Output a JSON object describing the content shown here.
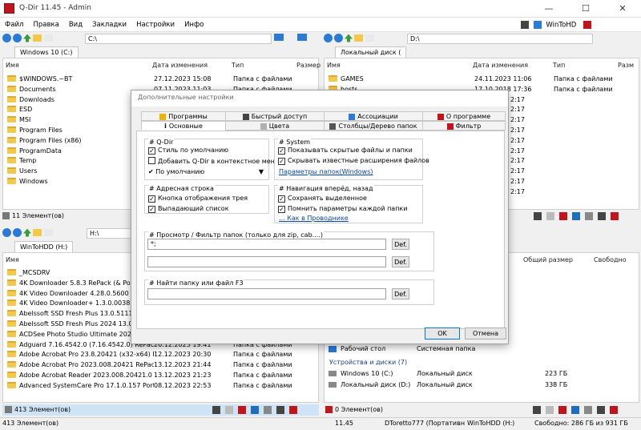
{
  "window": {
    "title": "Q-Dir 11.45 - Admin",
    "minimize": "—",
    "maximize": "☐",
    "close": "✕"
  },
  "menu": [
    "Файл",
    "Правка",
    "Вид",
    "Закладки",
    "Настройки",
    "Инфо"
  ],
  "menu_right": {
    "label": "WinToHD"
  },
  "pane_tl": {
    "address": "C:\\",
    "tab": "Windows 10 (C:)",
    "columns": [
      "Имя",
      "Дата изменения",
      "Тип",
      "Размер"
    ],
    "rows": [
      {
        "name": "$WINDOWS.~BT",
        "date": "27.12.2023 15:08",
        "type": "Папка с файлами"
      },
      {
        "name": "Documents",
        "date": "07.11.2023 11:03",
        "type": "Папка с файлами"
      },
      {
        "name": "Downloads",
        "date": "",
        "type": ""
      },
      {
        "name": "ESD",
        "date": "",
        "type": ""
      },
      {
        "name": "MSI",
        "date": "",
        "type": ""
      },
      {
        "name": "Program Files",
        "date": "",
        "type": ""
      },
      {
        "name": "Program Files (x86)",
        "date": "",
        "type": ""
      },
      {
        "name": "ProgramData",
        "date": "",
        "type": ""
      },
      {
        "name": "Temp",
        "date": "",
        "type": ""
      },
      {
        "name": "Users",
        "date": "",
        "type": ""
      },
      {
        "name": "Windows",
        "date": "",
        "type": ""
      }
    ],
    "status": "11 Элемент(ов)"
  },
  "pane_tr": {
    "address": "D:\\",
    "tab": "Локальный диск (",
    "columns": [
      "Имя",
      "Дата изменения",
      "Тип",
      "Разм"
    ],
    "rows": [
      {
        "name": "GAMES",
        "date": "24.11.2023 11:06",
        "type": "Папка с файлами"
      },
      {
        "name": "hosts",
        "date": "17.10.2018 17:36",
        "type": "Папка с файлами"
      },
      {
        "name": "",
        "date": "2:17",
        "type": ""
      },
      {
        "name": "",
        "date": "2:17",
        "type": ""
      },
      {
        "name": "",
        "date": "2:17",
        "type": ""
      },
      {
        "name": "",
        "date": "2:17",
        "type": ""
      },
      {
        "name": "",
        "date": "2:17",
        "type": ""
      },
      {
        "name": "",
        "date": "2:17",
        "type": ""
      },
      {
        "name": "",
        "date": "2:17",
        "type": ""
      },
      {
        "name": "",
        "date": "2:17",
        "type": ""
      },
      {
        "name": "",
        "date": "2:17",
        "type": ""
      },
      {
        "name": "",
        "date": "2:17",
        "type": ""
      }
    ]
  },
  "pane_bl": {
    "address": "H:\\",
    "tab": "WinToHDD (H:)",
    "columns": [
      "Имя"
    ],
    "rows": [
      {
        "name": "_MCSDRV",
        "date": "",
        "type": ""
      },
      {
        "name": "4K Downloader 5.8.3 RePack (& Portable",
        "date": "",
        "type": ""
      },
      {
        "name": "4K Video Downloader 4.28.0.5600 RePack",
        "date": "",
        "type": ""
      },
      {
        "name": "4K Video Downloader+ 1.3.0.0038 RePac",
        "date": "",
        "type": ""
      },
      {
        "name": "Abelssoft SSD Fresh Plus 13.0.51115 Port",
        "date": "",
        "type": ""
      },
      {
        "name": "Abelssoft SSD Fresh Plus 2024 13.0.5111",
        "date": "",
        "type": ""
      },
      {
        "name": "ACDSee Photo Studio Ultimate 2024 17.0",
        "date": "",
        "type": ""
      },
      {
        "name": "Adguard 7.16.4542.0 (7.16.4542.0) RePack by KpoJ...",
        "date": "26.12.2023 19:41",
        "type": "Папка с файлами"
      },
      {
        "name": "Adobe Acrobat Pro 23.8.20421 (x32-x64) RePack b...",
        "date": "12.12.2023 20:30",
        "type": "Папка с файлами"
      },
      {
        "name": "Adobe Acrobat Pro 2023.008.20421 RePack b...",
        "date": "13.12.2023 21:44",
        "type": "Папка с файлами"
      },
      {
        "name": "Adobe Acrobat Reader 2023.008.20421.0",
        "date": "13.12.2023 21:23",
        "type": "Папка с файлами"
      },
      {
        "name": "Advanced SystemCare Pro 17.1.0.157 Portab...",
        "date": "08.12.2023 22:53",
        "type": "Папка с файлами"
      }
    ],
    "status": "413 Элемент(ов)"
  },
  "pane_br": {
    "columns": [
      "Общий размер",
      "Свободно"
    ],
    "rows": [
      {
        "name": "Рабочий стол",
        "type": "Системная папка",
        "size": ""
      },
      {
        "name": "Устройства и диски (7)",
        "type": "",
        "size": ""
      },
      {
        "name": "Windows 10 (C:)",
        "type": "Локальный диск",
        "size": "223 ГБ"
      },
      {
        "name": "Локальный диск (D:)",
        "type": "Локальный диск",
        "size": "338 ГБ"
      }
    ],
    "status": "0 Элемент(ов)"
  },
  "bottom_status": {
    "left": "413 Элемент(ов)",
    "version": "11.45",
    "user": "DToretto777 (Портативн",
    "drive": "WinToHDD (H:)",
    "free": "Свободно: 286 ГБ из 931 ГБ"
  },
  "dialog": {
    "title": "Дополнительные настройки",
    "tabs_row1": [
      "Программы",
      "Быстрый доступ",
      "Ассоциации",
      "О программе"
    ],
    "tabs_row2": [
      "Основные",
      "Цвета",
      "Столбцы/Дерево папок",
      "Фильтр"
    ],
    "qdir": {
      "title": "# Q-Dir",
      "opt1": "Стиль по умолчанию",
      "opt2": "Добавить Q-Dir в контекстное меню",
      "dropdown": "По умолчанию"
    },
    "system": {
      "title": "# System",
      "opt1": "Показывать скрытые файлы и папки",
      "opt2": "Скрывать известные расширения файлов",
      "link": "Параметры папок(Windows)"
    },
    "address": {
      "title": "# Адресная строка",
      "opt1": "Кнопка отображения трея",
      "opt2": "Выпадающий список"
    },
    "nav": {
      "title": "# Навигация вперёд, назад",
      "opt1": "Сохранять выделенное",
      "opt2": "Помнить параметры каждой папки",
      "link": "... Как в Проводнике"
    },
    "filter": {
      "title": "# Просмотр / Фильтр папок (только для zip, cab....)",
      "value1": "*;",
      "value2": "",
      "def": "Def."
    },
    "find": {
      "title": "# Найти папку или файл    F3",
      "value": "",
      "def": "Def."
    },
    "ok": "OK",
    "cancel": "Отмена"
  },
  "colors": {
    "accent": "#0078d7",
    "folder": "#f3c84b",
    "app_red": "#c2151b"
  }
}
